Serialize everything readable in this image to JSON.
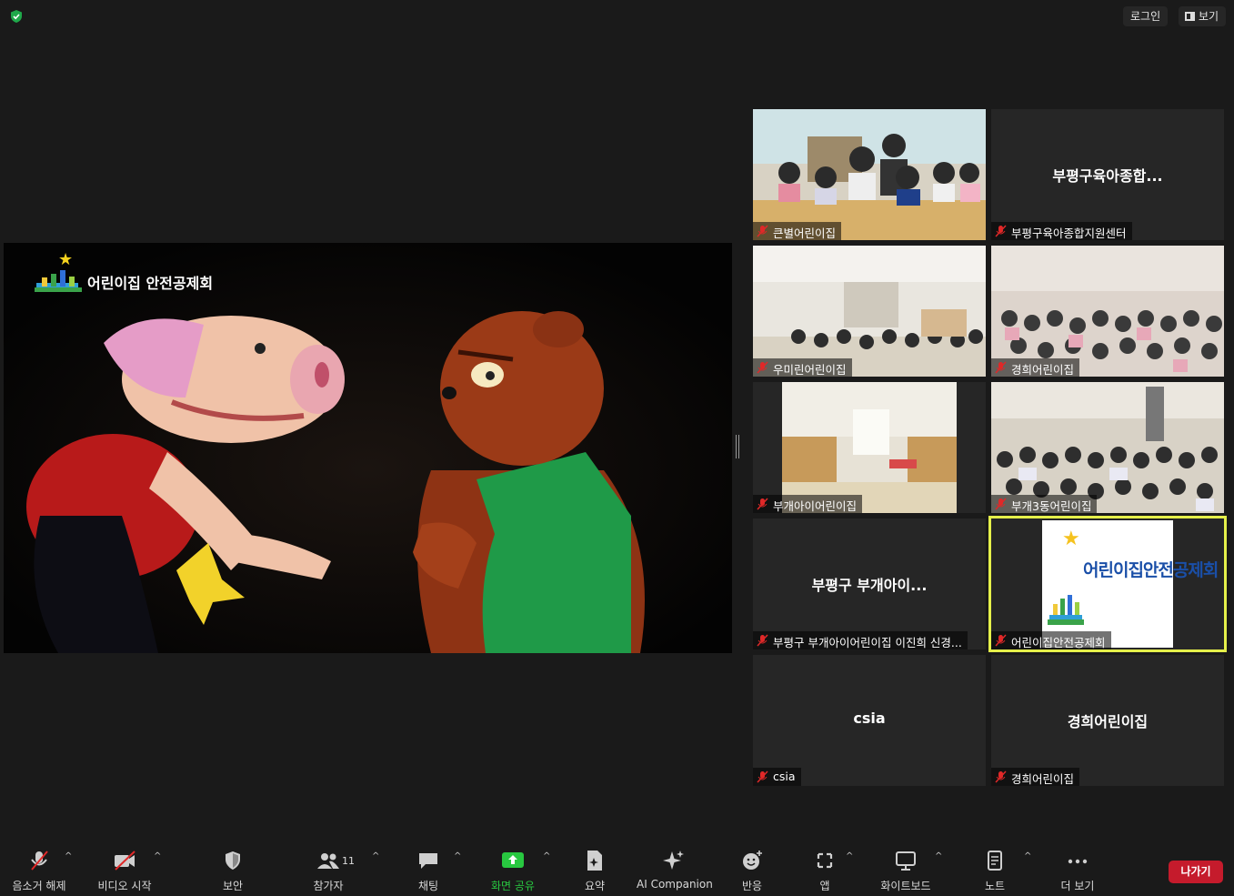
{
  "topbar": {
    "login_label": "로그인",
    "view_label": "보기"
  },
  "share": {
    "logo_text": "어린이집 안전공제회"
  },
  "tiles": [
    {
      "big_name": "",
      "name_tag": "큰별어린이집",
      "has_video": true
    },
    {
      "big_name": "부평구육아종합...",
      "name_tag": "부평구육아종합지원센터",
      "has_video": false
    },
    {
      "big_name": "",
      "name_tag": "우미린어린이집",
      "has_video": true
    },
    {
      "big_name": "",
      "name_tag": "경희어린이집",
      "has_video": true
    },
    {
      "big_name": "",
      "name_tag": "부개아이어린이집",
      "has_video": true
    },
    {
      "big_name": "",
      "name_tag": "부개3동어린이집",
      "has_video": true
    },
    {
      "big_name": "부평구 부개아이...",
      "name_tag": "부평구 부개아이어린이집 이진희 신경...",
      "has_video": false
    },
    {
      "big_name": "",
      "name_tag": "어린이집안전공제회",
      "has_video": true,
      "logo_text": "어린이집안전공제회"
    },
    {
      "big_name": "csia",
      "name_tag": "csia",
      "has_video": false
    },
    {
      "big_name": "경희어린이집",
      "name_tag": "경희어린이집",
      "has_video": false
    }
  ],
  "toolbar": {
    "mute": "음소거 해제",
    "video": "비디오 시작",
    "security": "보안",
    "participants": "참가자",
    "participants_count": "11",
    "chat": "채팅",
    "share": "화면 공유",
    "summary": "요약",
    "ai": "AI Companion",
    "reactions": "반응",
    "apps": "앱",
    "whiteboard": "화이트보드",
    "notes": "노트",
    "more": "더 보기",
    "leave": "나가기"
  },
  "colors": {
    "share_green": "#28c840",
    "leave_red": "#c51b2c",
    "active_outline": "#e5f04a",
    "mute_red": "#e02828"
  }
}
